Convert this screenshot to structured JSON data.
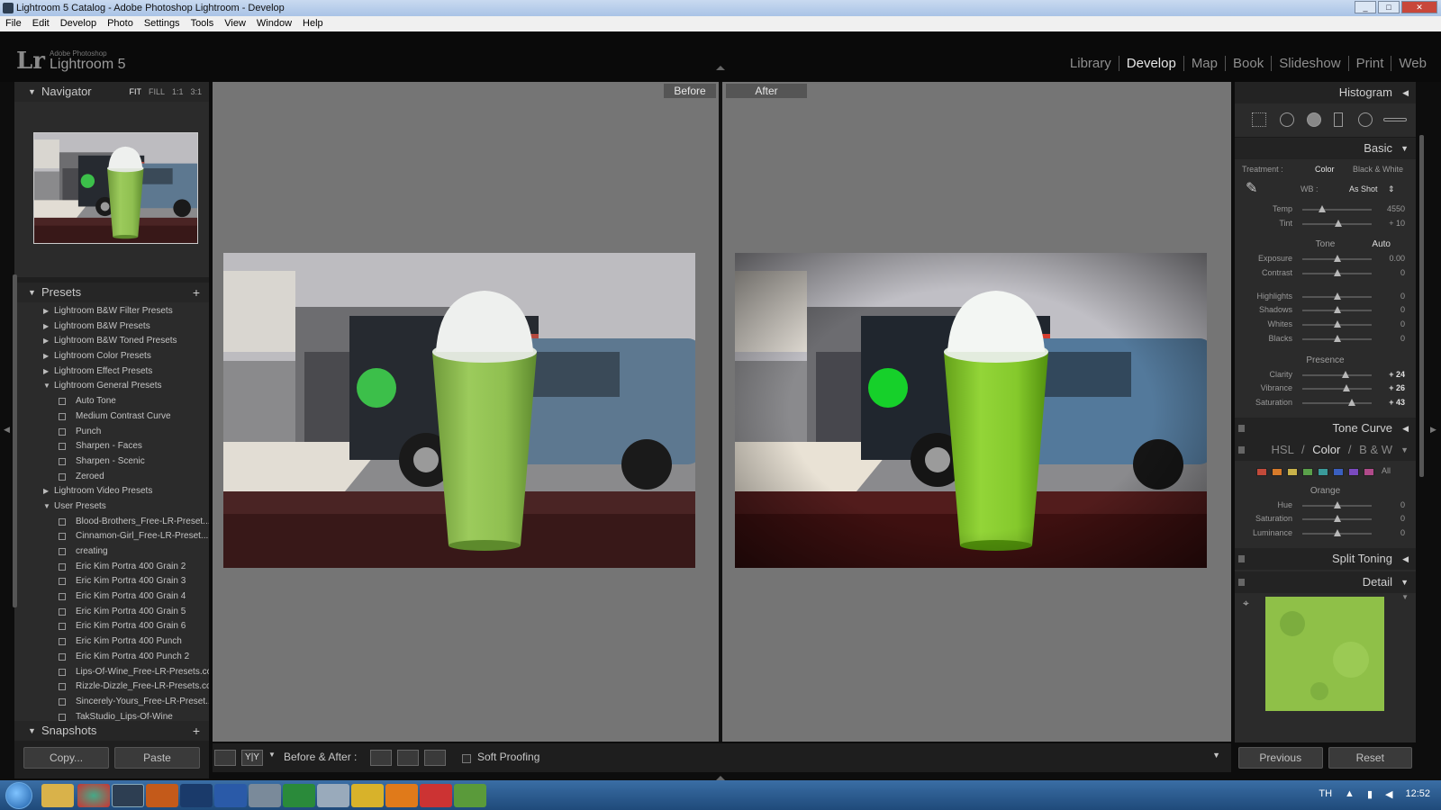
{
  "window": {
    "title": "Lightroom 5 Catalog - Adobe Photoshop Lightroom - Develop"
  },
  "menu": [
    "File",
    "Edit",
    "Develop",
    "Photo",
    "Settings",
    "Tools",
    "View",
    "Window",
    "Help"
  ],
  "identity": {
    "logo": "Lr",
    "vendor": "Adobe Photoshop",
    "product": "Lightroom 5"
  },
  "modules": [
    {
      "label": "Library",
      "active": false
    },
    {
      "label": "Develop",
      "active": true
    },
    {
      "label": "Map",
      "active": false
    },
    {
      "label": "Book",
      "active": false
    },
    {
      "label": "Slideshow",
      "active": false
    },
    {
      "label": "Print",
      "active": false
    },
    {
      "label": "Web",
      "active": false
    }
  ],
  "navigator": {
    "title": "Navigator",
    "options": [
      "FIT",
      "FILL",
      "1:1",
      "3:1"
    ],
    "selected": "FIT"
  },
  "presets": {
    "title": "Presets",
    "add": "+",
    "items": [
      {
        "type": "folder",
        "label": "Lightroom B&W Filter Presets",
        "open": false
      },
      {
        "type": "folder",
        "label": "Lightroom B&W Presets",
        "open": false
      },
      {
        "type": "folder",
        "label": "Lightroom B&W Toned Presets",
        "open": false
      },
      {
        "type": "folder",
        "label": "Lightroom Color Presets",
        "open": false
      },
      {
        "type": "folder",
        "label": "Lightroom Effect Presets",
        "open": false
      },
      {
        "type": "folder",
        "label": "Lightroom General Presets",
        "open": true
      },
      {
        "type": "preset",
        "label": "Auto Tone"
      },
      {
        "type": "preset",
        "label": "Medium Contrast Curve"
      },
      {
        "type": "preset",
        "label": "Punch"
      },
      {
        "type": "preset",
        "label": "Sharpen - Faces"
      },
      {
        "type": "preset",
        "label": "Sharpen - Scenic"
      },
      {
        "type": "preset",
        "label": "Zeroed"
      },
      {
        "type": "folder",
        "label": "Lightroom Video Presets",
        "open": false
      },
      {
        "type": "folder",
        "label": "User Presets",
        "open": true
      },
      {
        "type": "preset",
        "label": "Blood-Brothers_Free-LR-Preset..."
      },
      {
        "type": "preset",
        "label": "Cinnamon-Girl_Free-LR-Preset..."
      },
      {
        "type": "preset",
        "label": "creating"
      },
      {
        "type": "preset",
        "label": "Eric Kim Portra 400 Grain 2"
      },
      {
        "type": "preset",
        "label": "Eric Kim Portra 400 Grain 3"
      },
      {
        "type": "preset",
        "label": "Eric Kim Portra 400 Grain 4"
      },
      {
        "type": "preset",
        "label": "Eric Kim Portra 400 Grain 5"
      },
      {
        "type": "preset",
        "label": "Eric Kim Portra 400 Grain 6"
      },
      {
        "type": "preset",
        "label": "Eric Kim Portra 400 Punch"
      },
      {
        "type": "preset",
        "label": "Eric Kim Portra 400 Punch 2"
      },
      {
        "type": "preset",
        "label": "Lips-Of-Wine_Free-LR-Presets.co"
      },
      {
        "type": "preset",
        "label": "Rizzle-Dizzle_Free-LR-Presets.co"
      },
      {
        "type": "preset",
        "label": "Sincerely-Yours_Free-LR-Preset..."
      },
      {
        "type": "preset",
        "label": "TakStudio_Lips-Of-Wine"
      }
    ]
  },
  "snapshots": {
    "title": "Snapshots",
    "add": "+"
  },
  "leftButtons": {
    "copy": "Copy...",
    "paste": "Paste"
  },
  "view": {
    "before_label": "Before",
    "after_label": "After"
  },
  "toolbar": {
    "mode_label": "Before & After :",
    "soft_proofing": "Soft Proofing",
    "soft_proofing_checked": false,
    "yy_label": "Y|Y"
  },
  "histogram": {
    "title": "Histogram"
  },
  "basic": {
    "title": "Basic",
    "treatment_label": "Treatment :",
    "treatment_color": "Color",
    "treatment_bw": "Black & White",
    "wb_label": "WB :",
    "wb_value": "As Shot",
    "wb_sliders": [
      {
        "label": "Temp",
        "value": "4550",
        "pos": 0.28,
        "strong": false
      },
      {
        "label": "Tint",
        "value": "+ 10",
        "pos": 0.52,
        "strong": false
      }
    ],
    "tone_label": "Tone",
    "auto_label": "Auto",
    "tone_sliders": [
      {
        "label": "Exposure",
        "value": "0.00",
        "pos": 0.5,
        "strong": false
      },
      {
        "label": "Contrast",
        "value": "0",
        "pos": 0.5,
        "strong": false
      }
    ],
    "range_sliders": [
      {
        "label": "Highlights",
        "value": "0",
        "pos": 0.5,
        "strong": false
      },
      {
        "label": "Shadows",
        "value": "0",
        "pos": 0.5,
        "strong": false
      },
      {
        "label": "Whites",
        "value": "0",
        "pos": 0.5,
        "strong": false
      },
      {
        "label": "Blacks",
        "value": "0",
        "pos": 0.5,
        "strong": false
      }
    ],
    "presence_label": "Presence",
    "presence_sliders": [
      {
        "label": "Clarity",
        "value": "+ 24",
        "pos": 0.62,
        "strong": true
      },
      {
        "label": "Vibrance",
        "value": "+ 26",
        "pos": 0.63,
        "strong": true
      },
      {
        "label": "Saturation",
        "value": "+ 43",
        "pos": 0.71,
        "strong": true
      }
    ]
  },
  "tone_curve": {
    "title": "Tone Curve"
  },
  "hsl": {
    "tab_hsl": "HSL",
    "tab_color": "Color",
    "tab_bw": "B & W",
    "sep": "/",
    "all_label": "All",
    "swatch_colors": [
      "#c24a3a",
      "#d67a2a",
      "#c9b24a",
      "#5aa04a",
      "#3a9a9a",
      "#3a5fbf",
      "#7a4abf",
      "#b04a8a"
    ],
    "color_name": "Orange",
    "sliders": [
      {
        "label": "Hue",
        "value": "0",
        "pos": 0.5,
        "strong": false
      },
      {
        "label": "Saturation",
        "value": "0",
        "pos": 0.5,
        "strong": false
      },
      {
        "label": "Luminance",
        "value": "0",
        "pos": 0.5,
        "strong": false
      }
    ]
  },
  "split_toning": {
    "title": "Split Toning"
  },
  "detail": {
    "title": "Detail"
  },
  "rightButtons": {
    "previous": "Previous",
    "reset": "Reset"
  },
  "tray": {
    "lang": "TH",
    "time": "12:52"
  }
}
